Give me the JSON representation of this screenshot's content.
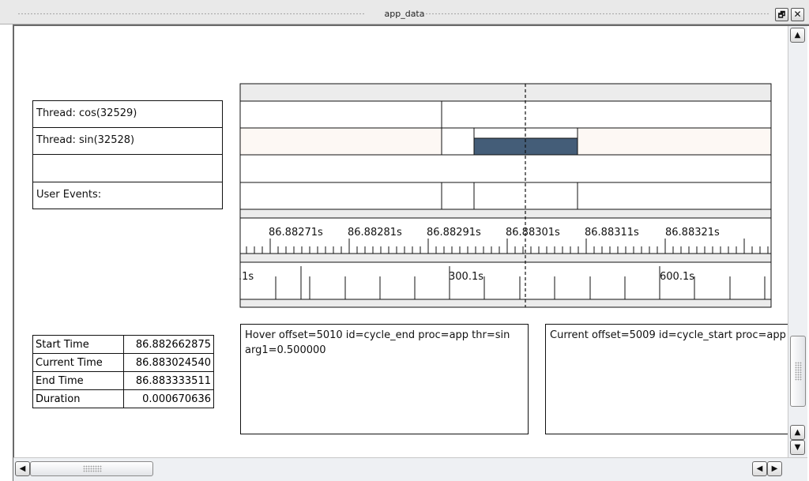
{
  "window": {
    "title": "app_data",
    "restore_glyph": "🗗",
    "close_glyph": "✕"
  },
  "threads": [
    {
      "label": "Thread: cos(32529)"
    },
    {
      "label": "Thread: sin(32528)"
    },
    {
      "label": ""
    },
    {
      "label": "User Events:"
    }
  ],
  "ruler_top": {
    "labels": [
      "86.88271s",
      "86.88281s",
      "86.88291s",
      "86.88301s",
      "86.88311s",
      "86.88321s"
    ]
  },
  "ruler_bottom": {
    "labels": [
      ".1s",
      "300.1s",
      "600.1s"
    ]
  },
  "stats": [
    {
      "key": "Start Time",
      "value": "86.882662875"
    },
    {
      "key": "Current Time",
      "value": "86.883024540"
    },
    {
      "key": "End Time",
      "value": "86.883333511"
    },
    {
      "key": "Duration",
      "value": "0.000670636"
    }
  ],
  "hover_info": {
    "line1": "Hover offset=5010  id=cycle_end  proc=app  thr=sin",
    "line2": "arg1=0.500000"
  },
  "current_info": {
    "line1": "Current offset=5009  id=cycle_start  proc=app"
  },
  "colors": {
    "event_bar": "#445d78",
    "track_tint": "#fdf8f4",
    "header_band": "#ececec"
  },
  "scrollbars": {
    "up_arrow": "▲",
    "down_arrow": "▼",
    "left_arrow": "◀",
    "right_arrow": "▶"
  }
}
